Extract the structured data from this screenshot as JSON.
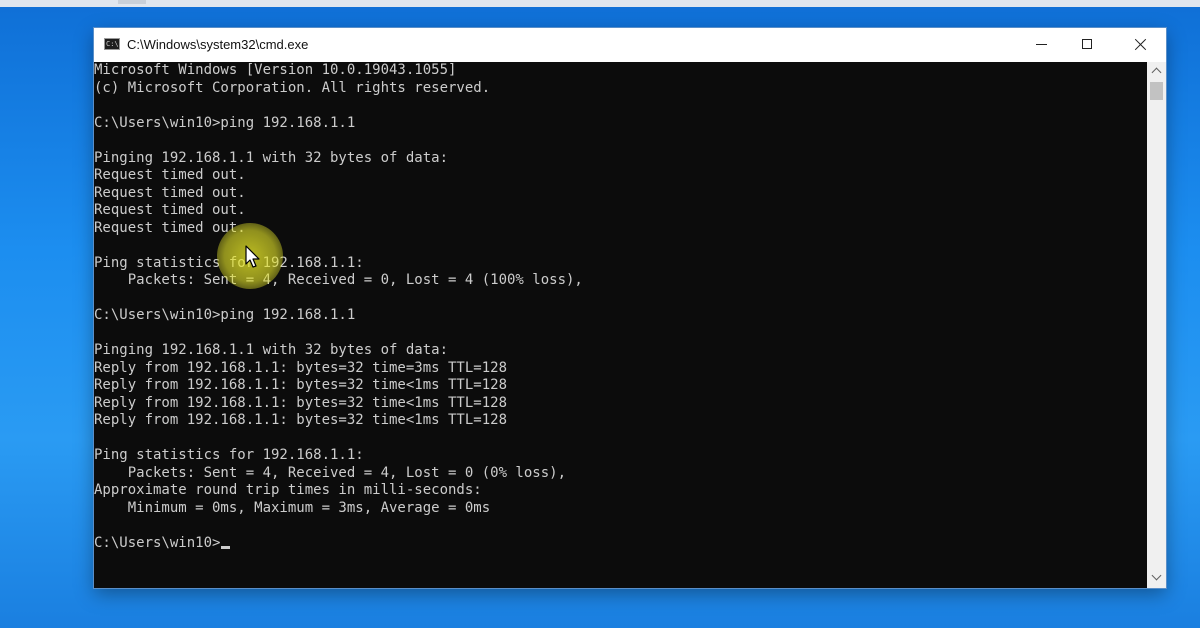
{
  "window": {
    "title": "C:\\Windows\\system32\\cmd.exe",
    "icon": "cmd-icon",
    "icon_glyph": "C:\\",
    "controls": {
      "minimize": "minimize-icon",
      "maximize": "maximize-icon",
      "close": "close-icon"
    }
  },
  "console": {
    "text_color": "#cccccc",
    "background_color": "#0c0c0c",
    "lines": [
      "Microsoft Windows [Version 10.0.19043.1055]",
      "(c) Microsoft Corporation. All rights reserved.",
      "",
      "C:\\Users\\win10>ping 192.168.1.1",
      "",
      "Pinging 192.168.1.1 with 32 bytes of data:",
      "Request timed out.",
      "Request timed out.",
      "Request timed out.",
      "Request timed out.",
      "",
      "Ping statistics for 192.168.1.1:",
      "    Packets: Sent = 4, Received = 0, Lost = 4 (100% loss),",
      "",
      "C:\\Users\\win10>ping 192.168.1.1",
      "",
      "Pinging 192.168.1.1 with 32 bytes of data:",
      "Reply from 192.168.1.1: bytes=32 time=3ms TTL=128",
      "Reply from 192.168.1.1: bytes=32 time<1ms TTL=128",
      "Reply from 192.168.1.1: bytes=32 time<1ms TTL=128",
      "Reply from 192.168.1.1: bytes=32 time<1ms TTL=128",
      "",
      "Ping statistics for 192.168.1.1:",
      "    Packets: Sent = 4, Received = 4, Lost = 0 (0% loss),",
      "Approximate round trip times in milli-seconds:",
      "    Minimum = 0ms, Maximum = 3ms, Average = 0ms",
      "",
      "C:\\Users\\win10>"
    ]
  },
  "scrollbar": {
    "up_icon": "chevron-up-icon",
    "down_icon": "chevron-down-icon"
  },
  "overlay": {
    "pointer_icon": "mouse-pointer-icon",
    "highlight_color": "#e6e628"
  }
}
